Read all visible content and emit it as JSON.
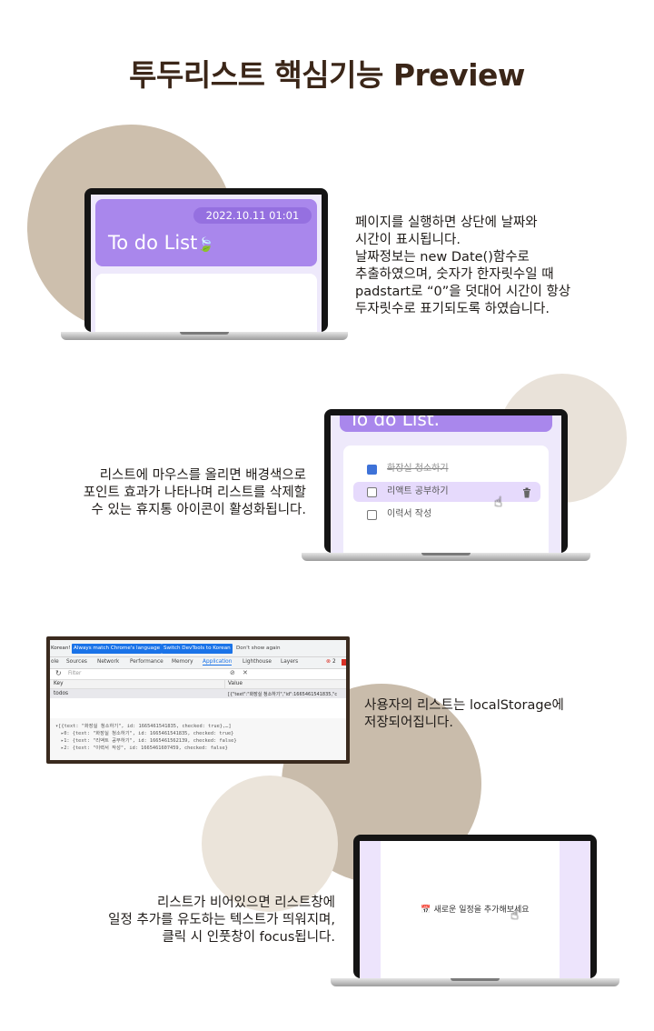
{
  "title": "투두리스트 핵심기능 Preview",
  "colors": {
    "title": "#3b2618",
    "circle_tan": "#cdbfad",
    "circle_light": "#e9e2d9",
    "circle_mid": "#c9bcab",
    "circle_pale": "#ebe4da",
    "header_purple": "#a987ec",
    "frame_brown": "#3a2a1e"
  },
  "section1": {
    "date": "2022.10.11   01:01",
    "brand": "To do List",
    "description": "페이지를 실행하면 상단에 날짜와\n시간이 표시됩니다.\n날짜정보는 new Date()함수로\n추출하였으며, 숫자가 한자릿수일 때\npadstart로 “0”을 덧대어 시간이 항상\n두자릿수로 표기되도록 하였습니다."
  },
  "section2": {
    "header_text": "To do List.",
    "todos": [
      {
        "text": "화장실 청소하기",
        "checked": true
      },
      {
        "text": "리액트 공부하기",
        "checked": false,
        "hover": true
      },
      {
        "text": "이력서 작성",
        "checked": false
      }
    ],
    "trash_icon": "trash-icon",
    "description": "리스트에 마우스를 올리면 배경색으로\n포인트 효과가 나타나며 리스트를 삭제할\n수 있는 휴지통 아이콘이 활성화됩니다."
  },
  "section3": {
    "devtools": {
      "infobar_prefix": "Korean!",
      "btn_match": "Always match Chrome's language",
      "btn_switch": "Switch DevTools to Korean",
      "dont_show": "Don't show again",
      "tabs": [
        "ole",
        "Sources",
        "Network",
        "Performance",
        "Memory",
        "Application",
        "Lighthouse",
        "Layers"
      ],
      "active_tab": "Application",
      "error_count": "2",
      "filter_placeholder": "Filter",
      "col_key": "Key",
      "col_value": "Value",
      "row_key": "todos",
      "row_value": "[{\"text\":\"화장실 청소하기\",\"id\":1665461541835,\"c",
      "console_lines": [
        "▾[{text: \"화장실 청소하기\", id: 1665461541835, checked: true},…]",
        "▸0: {text: \"화장실 청소하기\", id: 1665461541835, checked: true}",
        "▸1: {text: \"리액트 공부하기\", id: 1665461562139, checked: false}",
        "▸2: {text: \"이력서 작성\", id: 1665461607459, checked: false}"
      ]
    },
    "description": "사용자의 리스트는 localStorage에\n저장되어집니다."
  },
  "section4": {
    "prompt": "새로운 일정을 추가해보세요",
    "calendar_icon": "calendar-icon",
    "description": "리스트가 비어있으면 리스트창에\n일정 추가를 유도하는 텍스트가 띄워지며,\n클릭 시 인풋창이 focus됩니다."
  }
}
